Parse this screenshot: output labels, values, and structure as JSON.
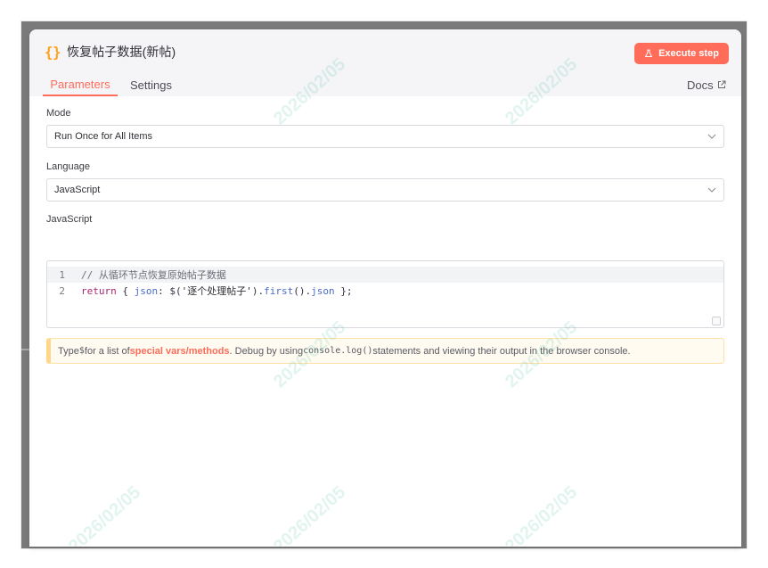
{
  "node": {
    "title": "恢复帖子数据(新帖)",
    "icon": "braces-icon"
  },
  "toolbar": {
    "execute_label": "Execute step"
  },
  "tabs": [
    {
      "label": "Parameters",
      "active": true
    },
    {
      "label": "Settings",
      "active": false
    }
  ],
  "docs": {
    "label": "Docs",
    "icon": "external-link-icon"
  },
  "fields": {
    "mode": {
      "label": "Mode",
      "value": "Run Once for All Items"
    },
    "language": {
      "label": "Language",
      "value": "JavaScript"
    },
    "code": {
      "label": "JavaScript",
      "line_numbers": [
        "1",
        "2"
      ],
      "lines": {
        "line1": "// 从循环节点恢复原始帖子数据",
        "line2": {
          "return": "return",
          "brace_open": " { ",
          "json_key": "json",
          "colon": ": $(",
          "string": "'逐个处理帖子'",
          "close_paren": ").",
          "first": "first",
          "call": "().",
          "json_tail": "json",
          "brace_close": " };"
        }
      }
    }
  },
  "hint": {
    "prefix": "Type ",
    "dollar": "$",
    "mid1": " for a list of ",
    "link": "special vars/methods",
    "mid2": ". Debug by using ",
    "console": "console.log()",
    "suffix": " statements and viewing their output in the browser console."
  },
  "watermark": {
    "text": "2026/02/05"
  },
  "colors": {
    "accent": "#ff6d5a",
    "icon_orange": "#ff9f1a",
    "hint_bg": "#fffbf1",
    "hint_border": "#ffd68a"
  }
}
